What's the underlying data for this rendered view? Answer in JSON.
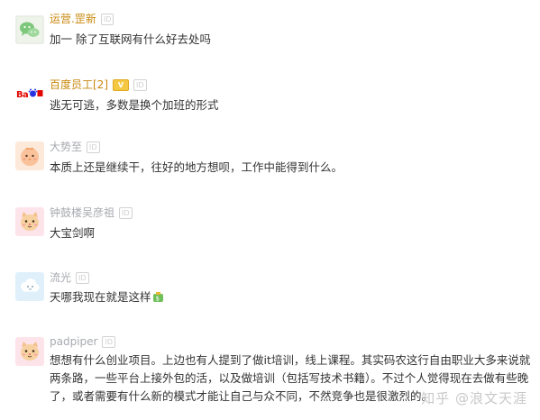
{
  "comments": [
    {
      "username": "运营.罡新",
      "id_badge": "ID",
      "text": "加一 除了互联网有什么好去处吗"
    },
    {
      "username": "百度员工[2]",
      "id_badge": "ID",
      "text": "逃无可逃，多数是换个加班的形式"
    },
    {
      "username": "大势至",
      "id_badge": "ID",
      "text": "本质上还是继续干，往好的地方想呗，工作中能得到什么。"
    },
    {
      "username": "钟鼓楼吴彦祖",
      "id_badge": "ID",
      "text": "大宝剑啊"
    },
    {
      "username": "流光",
      "id_badge": "ID",
      "text": "天哪我现在就是这样"
    },
    {
      "username": "padpiper",
      "id_badge": "ID",
      "text": "想想有什么创业项目。上边也有人提到了做it培训，线上课程。其实码农这行自由职业大多来说就两条路，一些平台上接外包的活，以及做培训（包括写技术书籍）。不过个人觉得现在去做有些晚了，或者需要有什么新的模式才能让自己与众不同，不然竞争也是很激烈的。"
    }
  ],
  "avatar_icons": [
    "wechat-icon",
    "baidu-logo",
    "chick-icon",
    "cat-icon",
    "cloud-icon",
    "cat-icon"
  ],
  "watermark": "知乎 @浪文天涯",
  "colors": {
    "username": "#c8870c",
    "username_gray": "#a8aab0",
    "text": "#333333",
    "wechat_green": "#7cc77a",
    "baidu_blue": "#2932e1",
    "baidu_red": "#e10601"
  }
}
